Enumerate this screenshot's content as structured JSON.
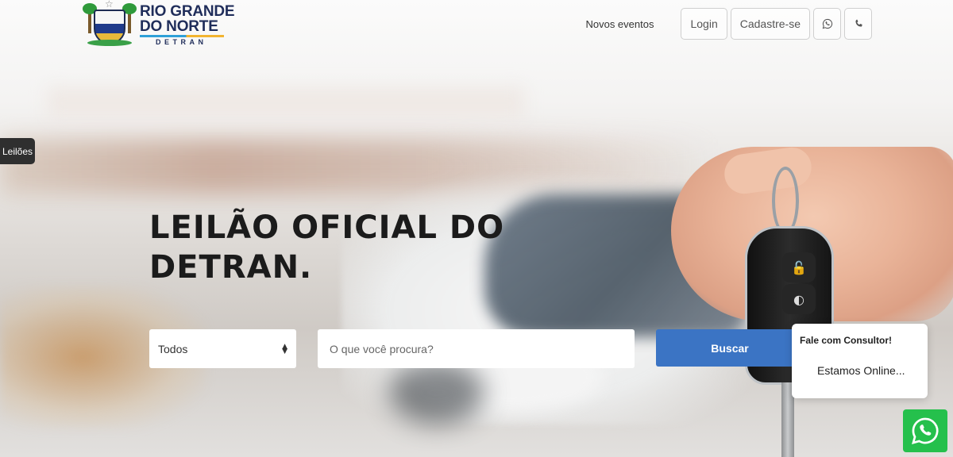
{
  "header": {
    "logo": {
      "line1": "RIO GRANDE",
      "line2": "DO NORTE",
      "line3": "DETRAN"
    },
    "nav": {
      "events_link": "Novos eventos",
      "login_button": "Login",
      "signup_button": "Cadastre-se",
      "whatsapp_icon": "whatsapp-icon",
      "phone_icon": "phone-icon"
    }
  },
  "side_tab": {
    "label": "Leilões"
  },
  "hero": {
    "title": "LEILÃO OFICIAL DO DETRAN.",
    "category_select": {
      "selected": "Todos"
    },
    "search": {
      "placeholder": "O que você procura?"
    },
    "search_button": "Buscar"
  },
  "chat": {
    "title": "Fale com Consultor!",
    "status": "Estamos Online...",
    "whatsapp_icon": "whatsapp-icon"
  },
  "colors": {
    "primary_button": "#3b74c4",
    "whatsapp_green": "#25c04c",
    "logo_navy": "#1f2d5a"
  }
}
